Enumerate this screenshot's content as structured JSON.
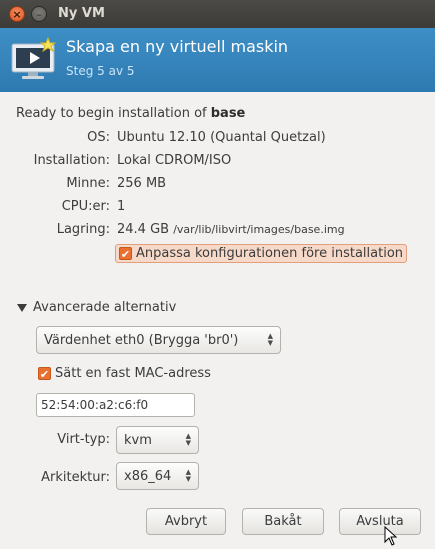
{
  "window": {
    "title": "Ny VM"
  },
  "header": {
    "title": "Skapa en ny virtuell maskin",
    "step": "Steg 5 av 5"
  },
  "summary": {
    "heading_prefix": "Ready to begin installation of ",
    "vm_name": "base",
    "rows": [
      {
        "label": "OS:",
        "value": "Ubuntu 12.10 (Quantal Quetzal)"
      },
      {
        "label": "Installation:",
        "value": "Lokal CDROM/ISO"
      },
      {
        "label": "Minne:",
        "value": "256 MB"
      },
      {
        "label": "CPU:er:",
        "value": "1"
      }
    ],
    "storage": {
      "label": "Lagring:",
      "size": "24.4 GB",
      "path": "/var/lib/libvirt/images/base.img"
    }
  },
  "customize_checkbox": {
    "label": "Anpassa konfigurationen före installation",
    "checked": true
  },
  "advanced": {
    "expander_label": "Avancerade alternativ",
    "network_select": "Värdenhet eth0 (Brygga 'br0')",
    "mac_checkbox": {
      "label": "Sätt en fast MAC-adress",
      "checked": true
    },
    "mac_value": "52:54:00:a2:c6:f0",
    "virt_type": {
      "label": "Virt-typ:",
      "value": "kvm"
    },
    "arch": {
      "label": "Arkitektur:",
      "value": "x86_64"
    }
  },
  "buttons": {
    "cancel": "Avbryt",
    "back": "Bakåt",
    "finish": "Avsluta"
  },
  "colors": {
    "accent": "#2e7ab0",
    "checkbox": "#e9702f"
  }
}
